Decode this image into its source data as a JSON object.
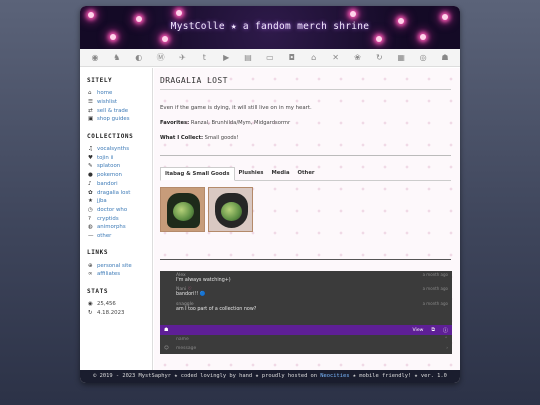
{
  "banner": {
    "title": "MystColle ★ a fandom merch shrine"
  },
  "navbar": {
    "icons": [
      "tumblr-icon",
      "mastodon-icon",
      "twitter-icon",
      "tumblr-t-icon",
      "youtube-icon",
      "twitch-icon",
      "folder-icon",
      "camera-icon",
      "home-icon",
      "crossed-swords-icon",
      "pikachu-icon",
      "bird-icon",
      "refresh-icon",
      "game-icon",
      "instagram-icon",
      "user-group-icon"
    ]
  },
  "sidebar": {
    "sitely_heading": "SITELY",
    "sitely_items": [
      {
        "icon": "home-icon",
        "glyph": "⌂",
        "label": "home"
      },
      {
        "icon": "list-icon",
        "glyph": "☰",
        "label": "wishlist"
      },
      {
        "icon": "swap-icon",
        "glyph": "⇄",
        "label": "sell & trade"
      },
      {
        "icon": "cart-icon",
        "glyph": "▣",
        "label": "shop guides"
      }
    ],
    "collections_heading": "COLLECTIONS",
    "collections_items": [
      {
        "icon": "headphones-icon",
        "glyph": "♫",
        "label": "vocalsynths"
      },
      {
        "icon": "heart-icon",
        "glyph": "♥",
        "label": "tojin ii"
      },
      {
        "icon": "brush-icon",
        "glyph": "✎",
        "label": "splatoon"
      },
      {
        "icon": "pokeball-icon",
        "glyph": "●",
        "label": "pokemon"
      },
      {
        "icon": "music-icon",
        "glyph": "♪",
        "label": "bandori"
      },
      {
        "icon": "dragon-icon",
        "glyph": "✿",
        "label": "dragalia lost"
      },
      {
        "icon": "star-icon",
        "glyph": "★",
        "label": "jjba"
      },
      {
        "icon": "clock-icon",
        "glyph": "◷",
        "label": "doctor who"
      },
      {
        "icon": "question-icon",
        "glyph": "?",
        "label": "cryptids"
      },
      {
        "icon": "globe-icon",
        "glyph": "◍",
        "label": "animorphs"
      },
      {
        "icon": "dash-icon",
        "glyph": "—",
        "label": "other"
      }
    ],
    "links_heading": "LINKS",
    "links_items": [
      {
        "icon": "globe-icon",
        "glyph": "⊕",
        "label": "personal site"
      },
      {
        "icon": "link-icon",
        "glyph": "∞",
        "label": "affiliates"
      }
    ],
    "stats_heading": "STATS",
    "stats_items": [
      {
        "icon": "eye-icon",
        "glyph": "◉",
        "label": "25,456"
      },
      {
        "icon": "sync-icon",
        "glyph": "↻",
        "label": "4.18.2023"
      }
    ]
  },
  "main": {
    "title": "DRAGALIA LOST",
    "intro": "Even if the game is dying, it will still live on in my heart.",
    "favorites_label": "Favorites:",
    "favorites_value": "Ranzal, Brunhilda/Mym, Midgardsormr",
    "collect_label": "What I Collect:",
    "collect_value": "Small goods!",
    "tabs": [
      "Itabag & Small Goods",
      "Plushies",
      "Media",
      "Other"
    ]
  },
  "chat": {
    "messages": [
      {
        "author": "Alex",
        "text": "I'm always watching+)",
        "time": "a month ago"
      },
      {
        "author": "Nani",
        "text": "bandori!!",
        "time": "a month ago",
        "emoji": "🔵"
      },
      {
        "author": "snaggle",
        "text": "am I too part of a collection now?",
        "time": "a month ago"
      }
    ],
    "bar_view": "View",
    "name_placeholder": "name",
    "message_placeholder": "message"
  },
  "footer": {
    "pre": "© 2019 - 2023 MystSaphyr  ★  coded lovingly by hand  ★  proudly hosted on",
    "host": "Neocities",
    "post": "★  mobile friendly!  ★  ver. 1.0"
  }
}
